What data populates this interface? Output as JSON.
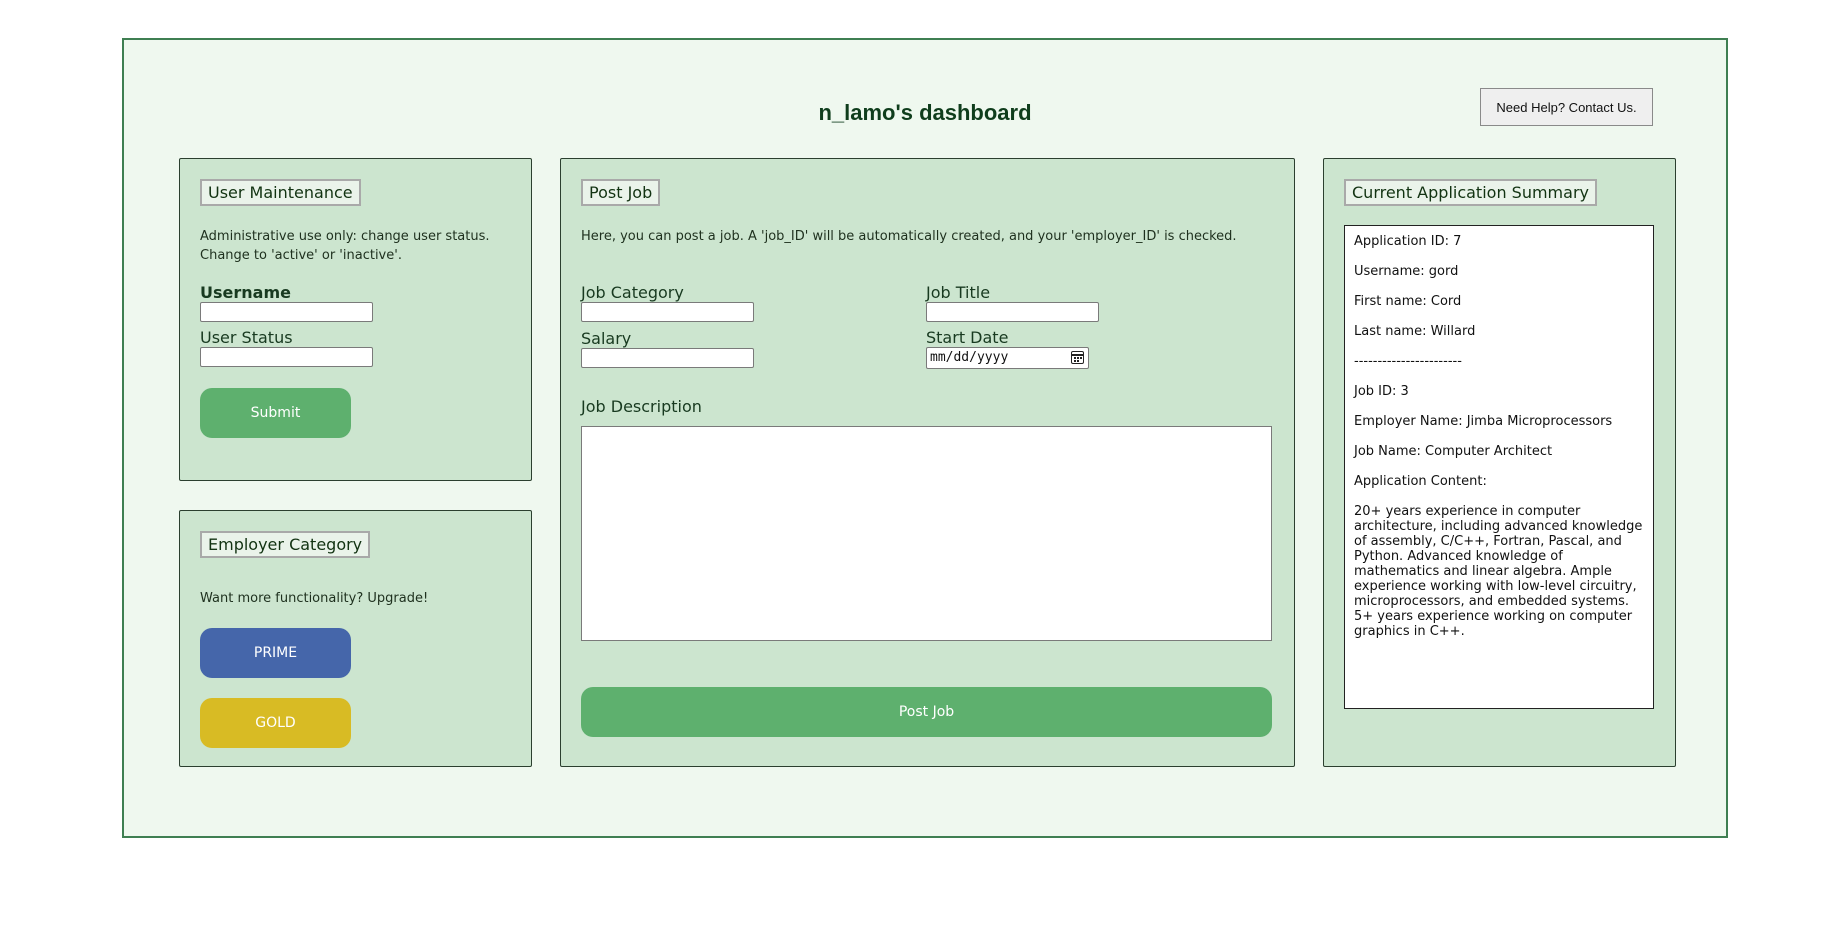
{
  "header": {
    "title": "n_lamo's dashboard",
    "help_label": "Need Help? Contact Us."
  },
  "user_maintenance": {
    "legend": "User Maintenance",
    "description": "Administrative use only: change user status. Change to 'active' or 'inactive'.",
    "username_label": "Username",
    "username_value": "",
    "status_label": "User Status",
    "status_value": "",
    "submit_label": "Submit"
  },
  "employer_category": {
    "legend": "Employer Category",
    "description": "Want more functionality? Upgrade!",
    "prime_label": "PRIME",
    "gold_label": "GOLD"
  },
  "post_job": {
    "legend": "Post Job",
    "description": "Here, you can post a job. A 'job_ID' will be automatically created, and your 'employer_ID' is checked.",
    "category_label": "Job Category",
    "title_label": "Job Title",
    "salary_label": "Salary",
    "start_date_label": "Start Date",
    "start_date_placeholder": "mm/dd/yyyy",
    "description_label": "Job Description",
    "description_value": "",
    "submit_label": "Post Job"
  },
  "summary": {
    "legend": "Current Application Summary",
    "lines": [
      "Application ID: 7",
      "Username: gord",
      "First name: Cord",
      "Last name: Willard",
      "-----------------------",
      "Job ID: 3",
      "Employer Name: Jimba Microprocessors",
      "Job Name: Computer Architect",
      "Application Content:",
      "20+ years experience in computer architecture, including advanced knowledge of assembly, C/C++, Fortran, Pascal, and Python. Advanced knowledge of mathematics and linear algebra. Ample experience working with low-level circuitry, microprocessors, and embedded systems. 5+ years experience working on computer graphics in C++."
    ]
  },
  "colors": {
    "frame_bg": "#eff8ef",
    "panel_bg": "#cce5cf",
    "green_button": "#5eb06e",
    "prime_button": "#4566aa",
    "gold_button": "#d8bb24",
    "title_text": "#0f3d1c"
  }
}
